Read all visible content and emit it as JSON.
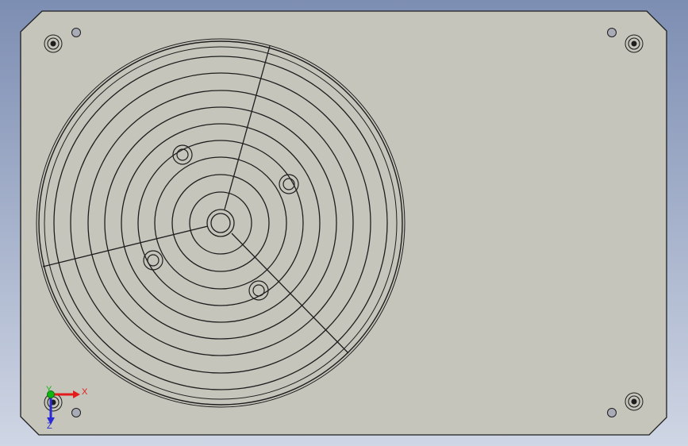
{
  "viewport": {
    "background_top": "#7d8eb3",
    "background_bottom": "#cfd6e4"
  },
  "part": {
    "face_color": "#c5c5bb",
    "edge_color": "#1e1e1e"
  },
  "triad": {
    "x_label": "X",
    "y_label": "Y",
    "z_label": "Z",
    "x_color": "#e31b1b",
    "y_color": "#11b511",
    "z_color": "#2a2ad6",
    "icons": [
      "axis-triad-icon"
    ]
  }
}
